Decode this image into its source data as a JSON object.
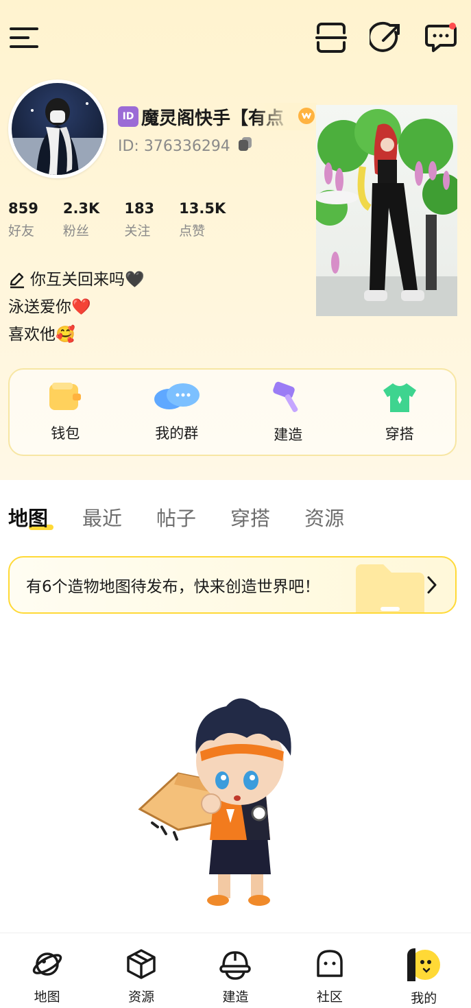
{
  "top_bar": {
    "icons": [
      "menu-icon",
      "scan-icon",
      "share-icon",
      "message-icon"
    ],
    "notification_dot_color": "#ff4d4f"
  },
  "profile": {
    "id_badge": "ID",
    "username": "魔灵阁快手【有点",
    "id_text": "ID: 376336294",
    "stats": [
      {
        "value": "859",
        "label": "好友"
      },
      {
        "value": "2.3K",
        "label": "粉丝"
      },
      {
        "value": "183",
        "label": "关注"
      },
      {
        "value": "13.5K",
        "label": "点赞"
      }
    ],
    "bio": [
      "你互关回来吗🖤",
      "泳送爱你❤️",
      "喜欢他🥰"
    ]
  },
  "shortcuts": [
    {
      "label": "钱包",
      "icon": "wallet-icon"
    },
    {
      "label": "我的群",
      "icon": "group-chat-icon"
    },
    {
      "label": "建造",
      "icon": "hammer-icon"
    },
    {
      "label": "穿搭",
      "icon": "outfit-icon"
    }
  ],
  "tabs": [
    {
      "label": "地图",
      "active": true
    },
    {
      "label": "最近",
      "active": false
    },
    {
      "label": "帖子",
      "active": false
    },
    {
      "label": "穿搭",
      "active": false
    },
    {
      "label": "资源",
      "active": false
    }
  ],
  "banner": {
    "text": "有6个造物地图待发布，快来创造世界吧！"
  },
  "bottom_nav": [
    {
      "label": "地图",
      "icon": "planet-icon"
    },
    {
      "label": "资源",
      "icon": "cube-icon"
    },
    {
      "label": "建造",
      "icon": "helmet-icon"
    },
    {
      "label": "社区",
      "icon": "ghost-icon"
    },
    {
      "label": "我的",
      "icon": "chick-icon",
      "active": true
    }
  ],
  "colors": {
    "accent_yellow": "#ffd936",
    "background": "#fff3cf"
  }
}
